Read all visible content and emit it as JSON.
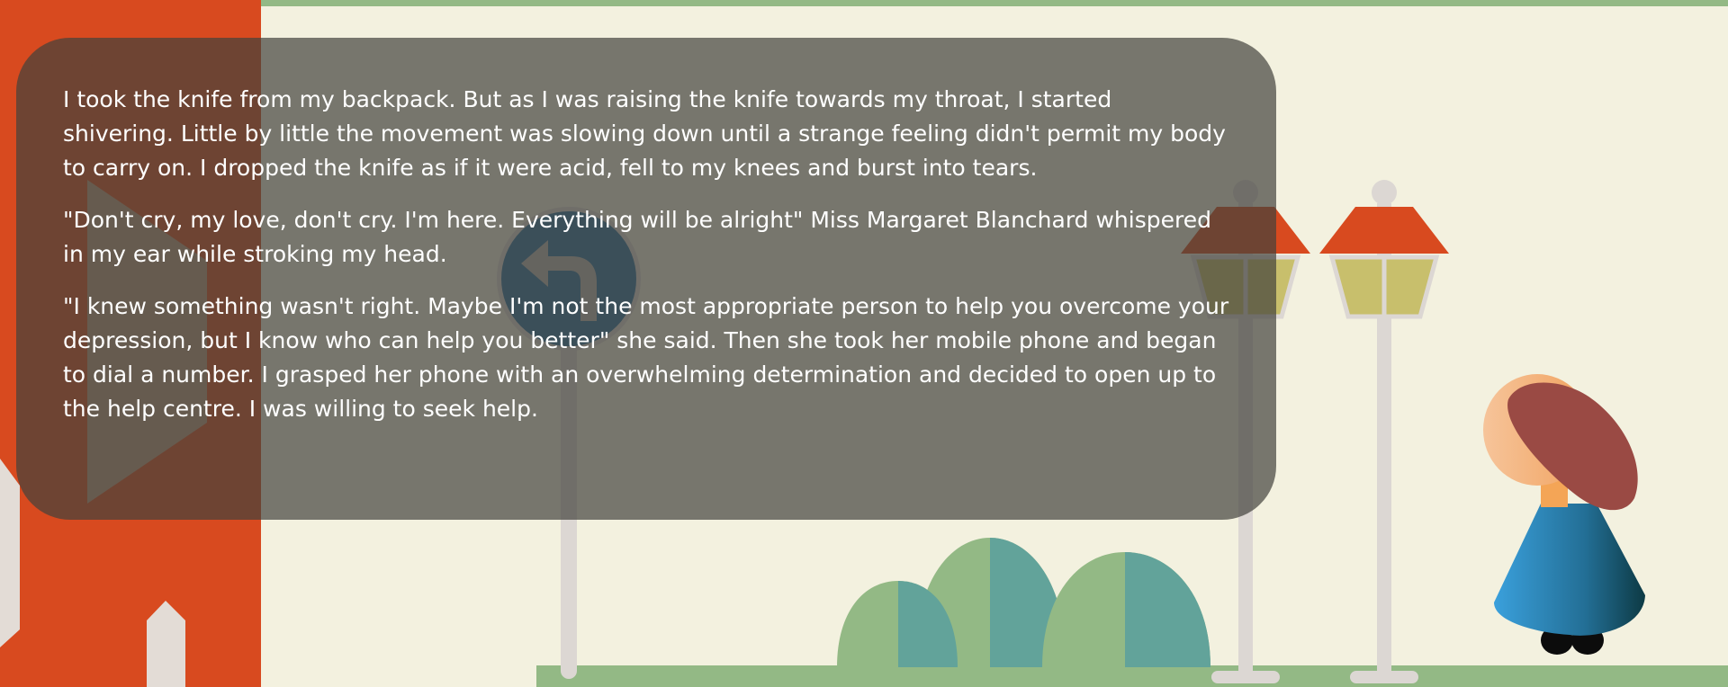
{
  "colors": {
    "background": "#f3f1df",
    "wall": "#d84a1f",
    "grass": "#93b985",
    "lamp_post": "#dcd7d3",
    "lamp_roof": "#d84a1f",
    "lamp_glass": "#c8bf6c",
    "back_button": "#2e6f9e",
    "bush_green": "#93b985",
    "bush_teal": "#62a39a",
    "overlay": "rgba(66,66,60,0.70)"
  },
  "icons": {
    "back": "undo-arrow-icon"
  },
  "narration": {
    "paragraphs": [
      "I took the knife from my backpack. But as I was raising the knife towards my throat, I started shivering. Little by little the movement was slowing down until a strange feeling didn't permit my body to carry on. I dropped the knife as if it were acid, fell to my knees and burst into tears.",
      "\"Don't cry, my love, don't cry. I'm here. Everything will be alright\" Miss Margaret Blanchard whispered in my ear while stroking my head.",
      "\"I knew something wasn't right. Maybe I'm not the most appropriate person to help you overcome your depression, but I know who can help you better\" she said. Then she took her mobile phone and began to dial a number. I grasped her phone with an overwhelming determination and decided to open up to the help centre. I was willing to seek help."
    ]
  }
}
